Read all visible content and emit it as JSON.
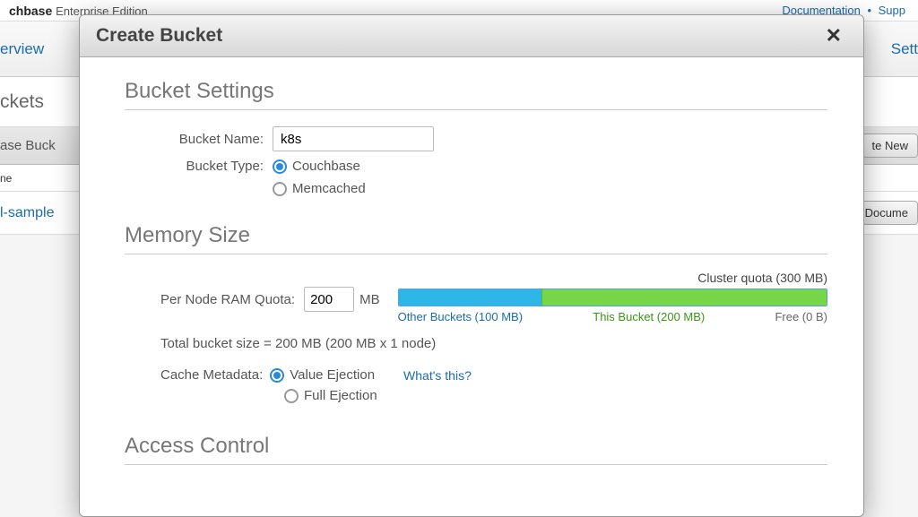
{
  "brand": {
    "name": "chbase",
    "edition": "Enterprise Edition"
  },
  "header_links": {
    "documentation": "Documentation",
    "support": "Supp"
  },
  "bg": {
    "tab_overview": "erview",
    "tab_settings": "Sett",
    "subtab": "ckets",
    "row3_left": "ase Buck",
    "row3_btn": "te New",
    "row4": "ne",
    "row5_left": "l-sample",
    "row5_btn": "Docume"
  },
  "modal": {
    "title": "Create Bucket",
    "sections": {
      "bucket_settings": "Bucket Settings",
      "memory_size": "Memory Size",
      "access_control": "Access Control"
    },
    "labels": {
      "bucket_name": "Bucket Name:",
      "bucket_type": "Bucket Type:",
      "per_node_ram": "Per Node RAM Quota:",
      "mb": "MB",
      "cache_metadata": "Cache Metadata:",
      "whats_this": "What's this?"
    },
    "values": {
      "bucket_name": "k8s",
      "per_node_ram": "200"
    },
    "bucket_types": {
      "couchbase": "Couchbase",
      "memcached": "Memcached",
      "selected": "couchbase"
    },
    "memory": {
      "cluster_quota_label": "Cluster quota (300 MB)",
      "other_pct": 33.3,
      "this_pct": 66.7,
      "free_pct": 0,
      "legend_other": "Other Buckets (100 MB)",
      "legend_this": "This Bucket (200 MB)",
      "legend_free": "Free (0 B)",
      "total_size": "Total bucket size = 200 MB (200 MB x 1 node)"
    },
    "cache_metadata": {
      "value_ejection": "Value Ejection",
      "full_ejection": "Full Ejection",
      "selected": "value_ejection"
    }
  }
}
